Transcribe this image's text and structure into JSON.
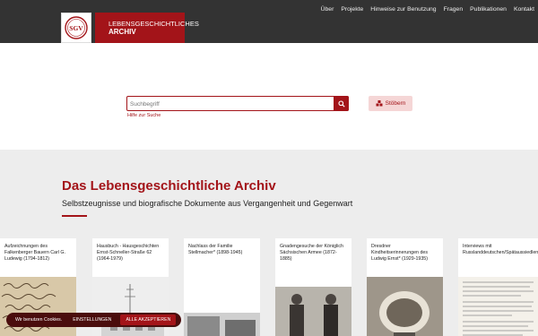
{
  "header": {
    "brand_line1": "LEBENSGESCHICHTLICHES",
    "brand_line2": "ARCHIV",
    "logo_text": "SGV",
    "nav": [
      "Über",
      "Projekte",
      "Hinweise zur Benutzung",
      "Fragen",
      "Publikationen",
      "Kontakt"
    ]
  },
  "search": {
    "placeholder": "Suchbegriff",
    "help_link": "Hilfe zur Suche",
    "browse_label": "Stöbern"
  },
  "archive": {
    "title": "Das Lebensgeschichtliche Archiv",
    "subtitle": "Selbstzeugnisse und biografische Dokumente aus Vergangenheit und Gegenwart",
    "cards": [
      {
        "title": "Aufzeichnungen des Falkenberger Bauern Carl G. Ludewig (1794-1812)"
      },
      {
        "title": "Hausbuch - Hausgeschichten Ernst-Schneller-Straße 62 (1964-1979)"
      },
      {
        "title": "Nachlass der Familie Stellmacher* (1898-1945)"
      },
      {
        "title": "Gnadengesuche der Königlich Sächsischen Armee (1872-1885)"
      },
      {
        "title": "Dresdner Kindheitserinnerungen des Ludwig Ernst* (1929-1935)"
      },
      {
        "title": "Interviews mit Russlanddeutschen/Spätaussiedlern"
      }
    ]
  },
  "cookie": {
    "text": "Wir benutzen Cookies.",
    "settings": "EINSTELLUNGEN",
    "accept": "ALLE AKZEPTIEREN"
  },
  "colors": {
    "accent": "#a31419",
    "header_bg": "#333333",
    "section_bg": "#ededed",
    "cookie_bg": "#4a0d0d"
  }
}
